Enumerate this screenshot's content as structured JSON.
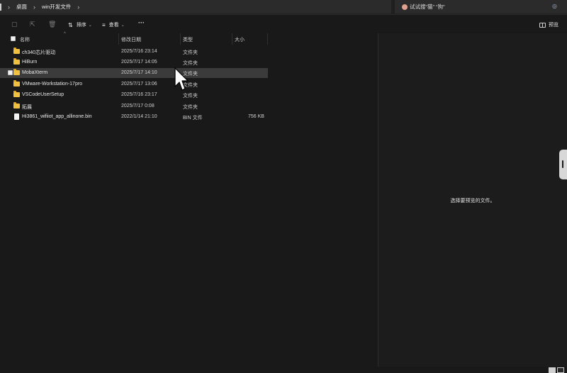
{
  "breadcrumb": [
    "桌面",
    "win开发文件"
  ],
  "search": {
    "text": "试试搜“猫” “狗”"
  },
  "toolbar": {
    "sort_label": "排序",
    "view_label": "查看",
    "more_label": "···",
    "preview_label": "预览"
  },
  "columns": {
    "name": "名称",
    "date": "修改日期",
    "type": "类型",
    "size": "大小"
  },
  "files": [
    {
      "name": "ch340芯片驱动",
      "date": "2025/7/16 23:14",
      "type": "文件夹",
      "size": "",
      "kind": "folder"
    },
    {
      "name": "HiBurn",
      "date": "2025/7/17 14:05",
      "type": "文件夹",
      "size": "",
      "kind": "folder"
    },
    {
      "name": "MobaXterm",
      "date": "2025/7/17 14:10",
      "type": "文件夹",
      "size": "",
      "kind": "folder",
      "selected": true
    },
    {
      "name": "VMware-Workstation-17pro",
      "date": "2025/7/17 13:06",
      "type": "文件夹",
      "size": "",
      "kind": "folder"
    },
    {
      "name": "VSCodeUserSetup",
      "date": "2025/7/16 23:17",
      "type": "文件夹",
      "size": "",
      "kind": "folder"
    },
    {
      "name": "拓展",
      "date": "2025/7/17 0:08",
      "type": "文件夹",
      "size": "",
      "kind": "folder"
    },
    {
      "name": "Hi3861_wifiiot_app_allinone.bin",
      "date": "2022/1/14 21:10",
      "type": "BIN 文件",
      "size": "756 KB",
      "kind": "file"
    }
  ],
  "preview": {
    "message": "选择要预览的文件。"
  }
}
